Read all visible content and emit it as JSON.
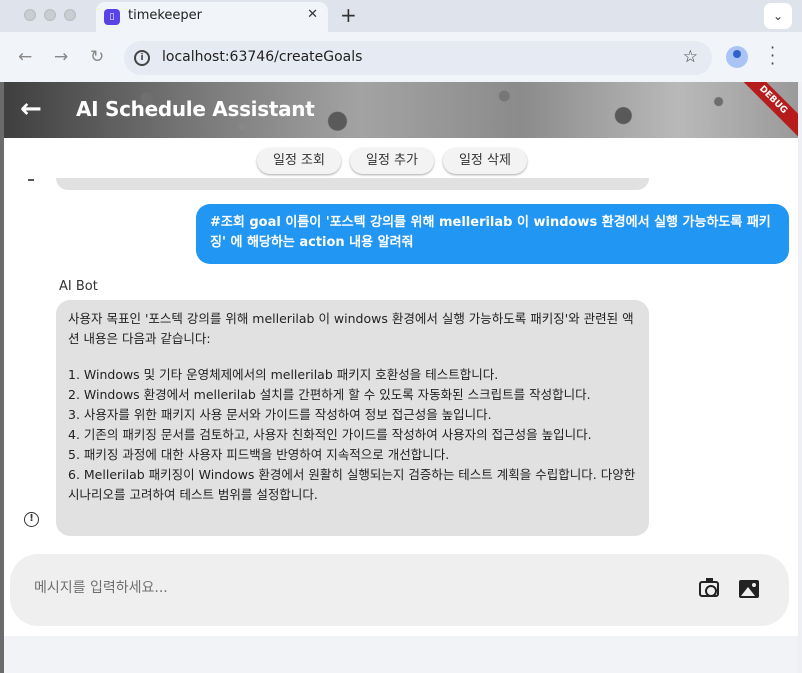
{
  "browser": {
    "tab_title": "timekeeper",
    "url": "localhost:63746/createGoals",
    "new_tab_symbol": "+",
    "tab_close_symbol": "✕",
    "tab_menu_symbol": "⌄"
  },
  "app": {
    "title": "AI Schedule Assistant",
    "debug_banner": "DEBUG",
    "chips": [
      "일정 조회",
      "일정 추가",
      "일정 삭제"
    ],
    "messages": {
      "user_message": "#조회 goal 이름이 '포스텍 강의를 위해 mellerilab 이 windows 환경에서 실행 가능하도록 패키징' 에 해당하는 action 내용 알려줘",
      "bot_name": "AI Bot",
      "bot_intro": "사용자 목표인 '포스텍 강의를 위해 mellerilab 이 windows 환경에서 실행 가능하도록 패키징'와 관련된 액션 내용은 다음과 같습니다:",
      "bot_items": [
        "1. Windows 및 기타 운영체제에서의 mellerilab 패키지 호환성을 테스트합니다.",
        "2. Windows 환경에서 mellerilab 설치를 간편하게 할 수 있도록 자동화된 스크립트를 작성합니다.",
        "3. 사용자를 위한 패키지 사용 문서와 가이드를 작성하여 정보 접근성을 높입니다.",
        "4. 기존의 패키징 문서를 검토하고, 사용자 친화적인 가이드를 작성하여 사용자의 접근성을 높입니다.",
        "5. 패키징 과정에 대한 사용자 피드백을 반영하여 지속적으로 개선합니다.",
        "6. Mellerilab 패키징이 Windows 환경에서 원활히 실행되는지 검증하는 테스트 계획을 수립합니다. 다양한 시나리오를 고려하여 테스트 범위를 설정합니다."
      ]
    },
    "composer": {
      "placeholder": "메시지를 입력하세요...",
      "value": ""
    }
  },
  "icons": [
    "back-arrow-icon",
    "reload-icon",
    "info-icon",
    "star-icon",
    "profile-icon",
    "kebab-menu-icon",
    "alert-icon",
    "camera-icon",
    "image-icon"
  ],
  "colors": {
    "user_bubble": "#2196f3",
    "bot_bubble": "#e1e1e1",
    "debug_banner": "#b71c1c"
  }
}
